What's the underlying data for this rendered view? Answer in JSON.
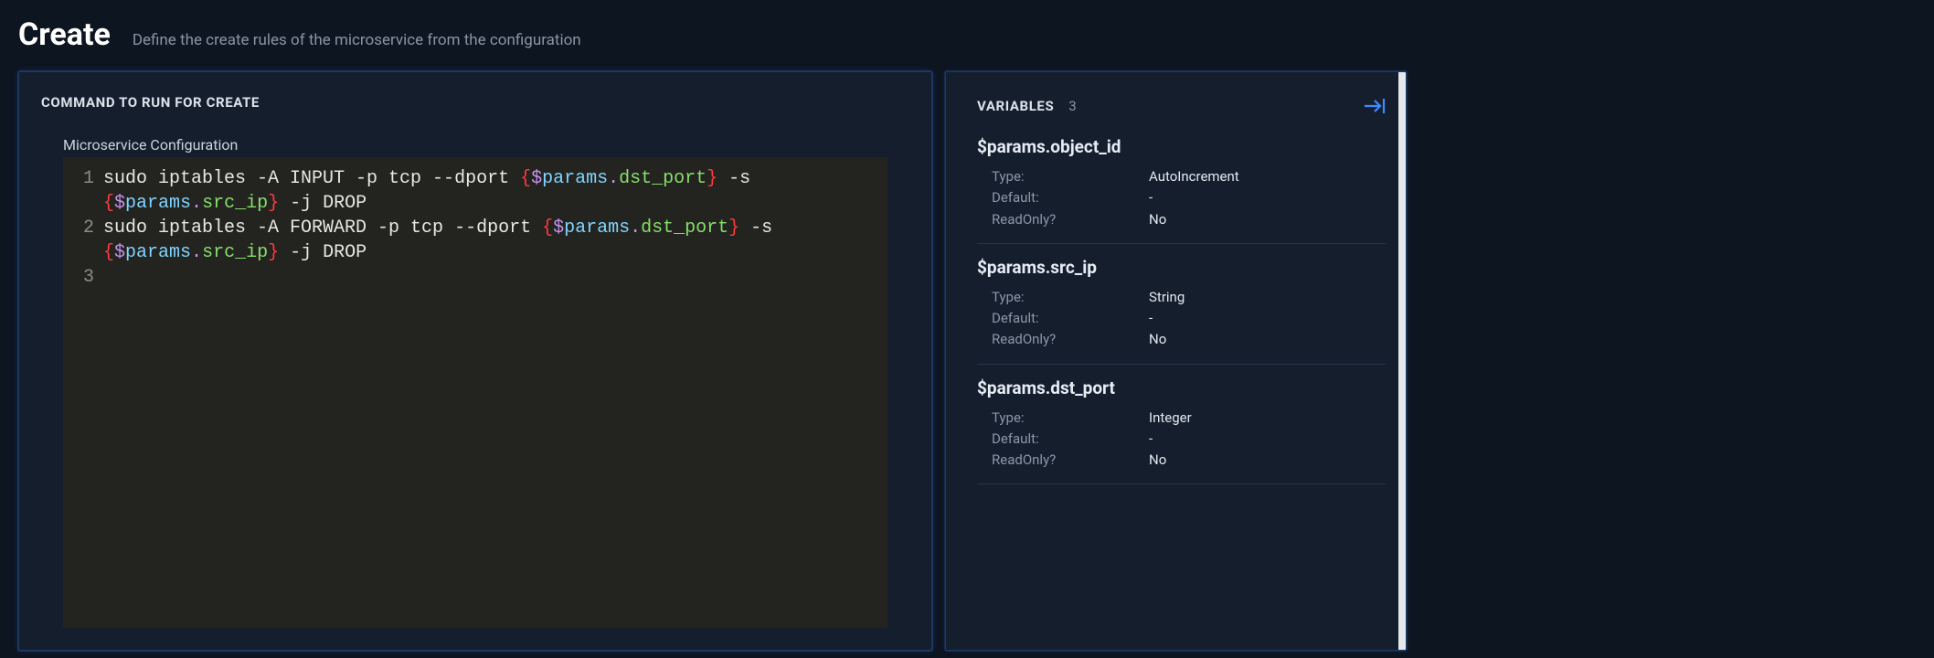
{
  "header": {
    "title": "Create",
    "subtitle": "Define the create rules of the microservice from the configuration"
  },
  "command_panel": {
    "title": "COMMAND TO RUN FOR CREATE",
    "config_label": "Microservice Configuration",
    "lines": [
      {
        "num": "1",
        "tokens": [
          {
            "t": "plain",
            "v": "sudo iptables -A INPUT -p tcp --dport "
          },
          {
            "t": "brace",
            "v": "{"
          },
          {
            "t": "dollar",
            "v": "$"
          },
          {
            "t": "obj",
            "v": "params"
          },
          {
            "t": "dot",
            "v": "."
          },
          {
            "t": "key",
            "v": "dst_port"
          },
          {
            "t": "brace",
            "v": "}"
          },
          {
            "t": "plain",
            "v": " -s "
          },
          {
            "t": "brace",
            "v": "{"
          },
          {
            "t": "dollar",
            "v": "$"
          },
          {
            "t": "obj",
            "v": "params"
          },
          {
            "t": "dot",
            "v": "."
          },
          {
            "t": "key",
            "v": "src_ip"
          },
          {
            "t": "brace",
            "v": "}"
          },
          {
            "t": "plain",
            "v": " -j DROP"
          }
        ]
      },
      {
        "num": "2",
        "tokens": [
          {
            "t": "plain",
            "v": "sudo iptables -A FORWARD -p tcp --dport "
          },
          {
            "t": "brace",
            "v": "{"
          },
          {
            "t": "dollar",
            "v": "$"
          },
          {
            "t": "obj",
            "v": "params"
          },
          {
            "t": "dot",
            "v": "."
          },
          {
            "t": "key",
            "v": "dst_port"
          },
          {
            "t": "brace",
            "v": "}"
          },
          {
            "t": "plain",
            "v": " -s "
          },
          {
            "t": "brace",
            "v": "{"
          },
          {
            "t": "dollar",
            "v": "$"
          },
          {
            "t": "obj",
            "v": "params"
          },
          {
            "t": "dot",
            "v": "."
          },
          {
            "t": "key",
            "v": "src_ip"
          },
          {
            "t": "brace",
            "v": "}"
          },
          {
            "t": "plain",
            "v": " -j DROP"
          }
        ]
      },
      {
        "num": "3",
        "tokens": []
      }
    ]
  },
  "variables_panel": {
    "title": "VARIABLES",
    "count": "3",
    "labels": {
      "type": "Type:",
      "default": "Default:",
      "readonly": "ReadOnly?"
    },
    "vars": [
      {
        "name": "$params.object_id",
        "type": "AutoIncrement",
        "default": "-",
        "readonly": "No"
      },
      {
        "name": "$params.src_ip",
        "type": "String",
        "default": "-",
        "readonly": "No"
      },
      {
        "name": "$params.dst_port",
        "type": "Integer",
        "default": "-",
        "readonly": "No"
      }
    ]
  }
}
